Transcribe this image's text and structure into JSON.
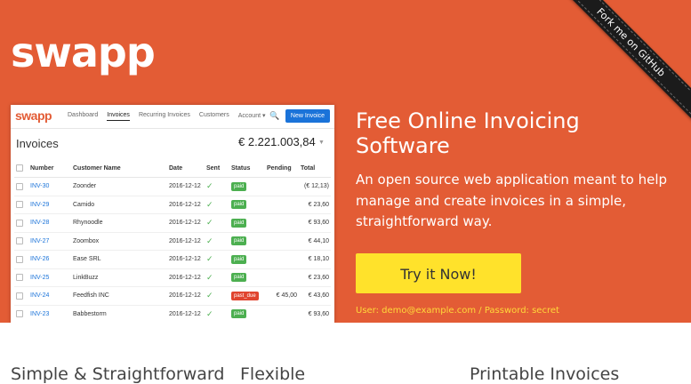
{
  "brand": {
    "logo_text": "swapp"
  },
  "ribbon": {
    "label": "Fork me on GitHub"
  },
  "app": {
    "logo": "swapp",
    "nav": [
      "Dashboard",
      "Invoices",
      "Recurring Invoices",
      "Customers",
      "Account ▾"
    ],
    "search_icon": "search-icon",
    "new_button": "New Invoice",
    "title": "Invoices",
    "total": "€ 2.221.003,84",
    "columns": [
      "Number",
      "Customer Name",
      "Date",
      "Sent",
      "Status",
      "Pending",
      "Total"
    ],
    "rows": [
      {
        "number": "INV-30",
        "customer": "Zoonder",
        "date": "2016-12-12",
        "status": "paid",
        "pending": "",
        "total": "(€ 12,13)"
      },
      {
        "number": "INV-29",
        "customer": "Camido",
        "date": "2016-12-12",
        "status": "paid",
        "pending": "",
        "total": "€ 23,60"
      },
      {
        "number": "INV-28",
        "customer": "Rhynoodle",
        "date": "2016-12-12",
        "status": "paid",
        "pending": "",
        "total": "€ 93,60"
      },
      {
        "number": "INV-27",
        "customer": "Zoombox",
        "date": "2016-12-12",
        "status": "paid",
        "pending": "",
        "total": "€ 44,10"
      },
      {
        "number": "INV-26",
        "customer": "Ease SRL",
        "date": "2016-12-12",
        "status": "paid",
        "pending": "",
        "total": "€ 18,10"
      },
      {
        "number": "INV-25",
        "customer": "LinkBuzz",
        "date": "2016-12-12",
        "status": "paid",
        "pending": "",
        "total": "€ 23,60"
      },
      {
        "number": "INV-24",
        "customer": "Feedfish INC",
        "date": "2016-12-12",
        "status": "past_due",
        "pending": "€ 45,00",
        "total": "€ 43,60"
      },
      {
        "number": "INV-23",
        "customer": "Babbestorm",
        "date": "2016-12-12",
        "status": "paid",
        "pending": "",
        "total": "€ 93,60"
      }
    ]
  },
  "hero": {
    "headline": "Free Online Invoicing Software",
    "description": "An open source web application meant to help manage and create invoices in a simple, straightforward way.",
    "cta": "Try it Now!",
    "credentials": "User: demo@example.com / Password: secret"
  },
  "features": [
    "Simple & Straightforward",
    "Flexible",
    "Printable Invoices"
  ],
  "colors": {
    "hero_bg": "#e35c35",
    "cta_bg": "#ffe22b",
    "credentials": "#ffd93a",
    "link": "#1a73d9"
  }
}
